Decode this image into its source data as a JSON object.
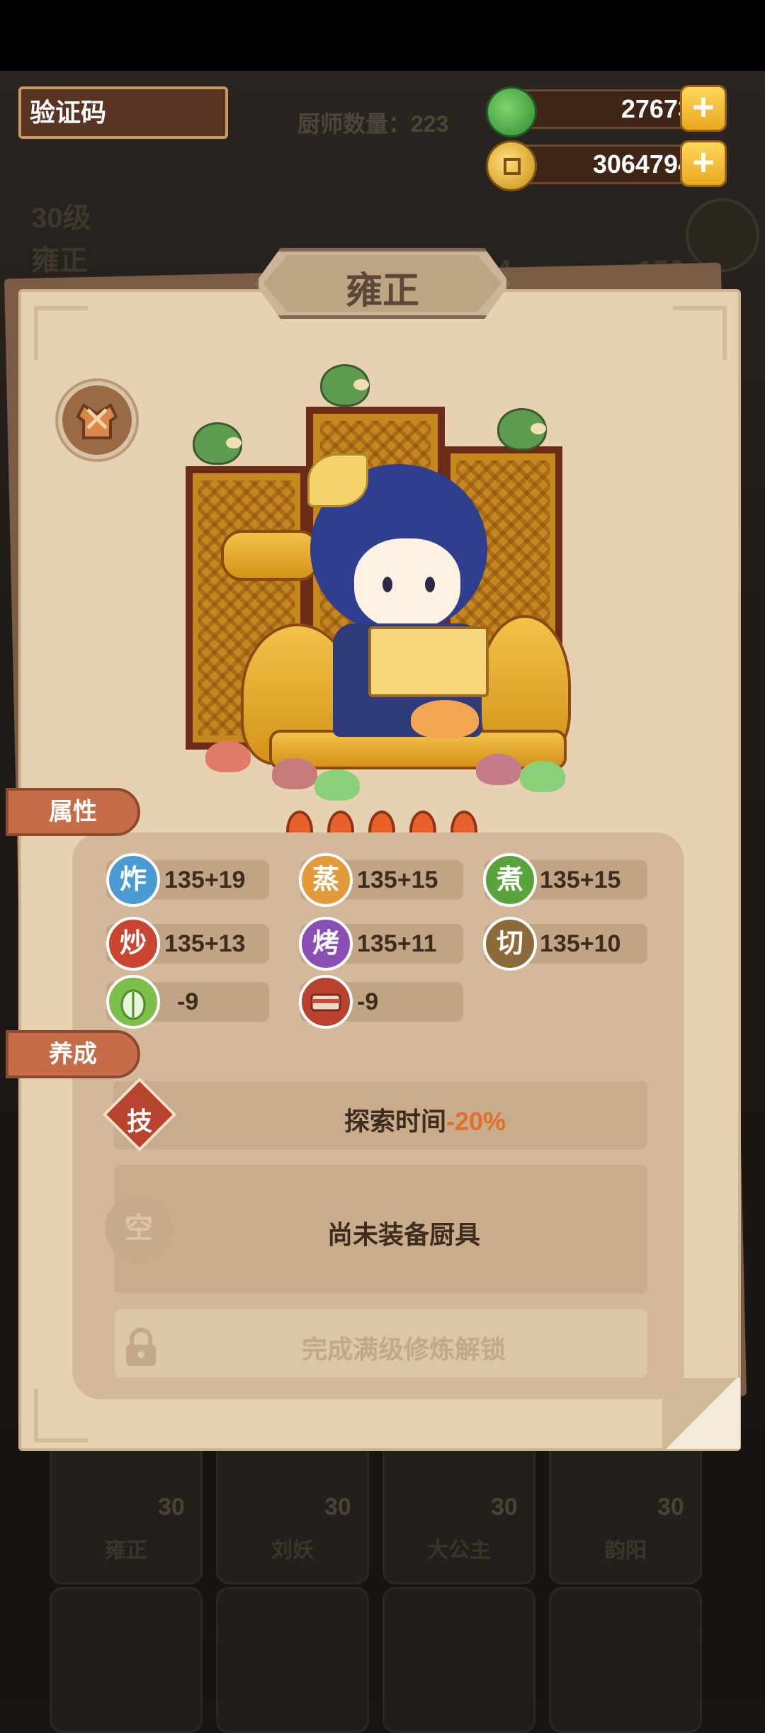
{
  "hud": {
    "captcha_label": "验证码",
    "jade_value": "27673",
    "coin_value": "3064794",
    "plus": "+",
    "colors": {
      "jade": "#3fa34a",
      "coin": "#e8b127",
      "plus": "#f5c23b"
    }
  },
  "background": {
    "chef_count": "厨师数量：223",
    "level": "30级",
    "name": "雍正",
    "num_a": "4",
    "num_b": "150",
    "cards": [
      {
        "level": "30",
        "name": "雍正"
      },
      {
        "level": "30",
        "name": "刘妖"
      },
      {
        "level": "30",
        "name": "大公主"
      },
      {
        "level": "30",
        "name": "韵阳"
      }
    ]
  },
  "panel": {
    "title": "雍正",
    "badge_icon": "chef-robe-icon",
    "flames": 5,
    "sections": {
      "attributes": "属性",
      "cultivation": "养成"
    },
    "stats": [
      {
        "icon_char": "炸",
        "value": "135+19",
        "color": "#4a9bd4"
      },
      {
        "icon_char": "蒸",
        "value": "135+15",
        "color": "#e39a3a"
      },
      {
        "icon_char": "煮",
        "value": "135+15",
        "color": "#5aa33c"
      },
      {
        "icon_char": "炒",
        "value": "135+13",
        "color": "#c9452f"
      },
      {
        "icon_char": "烤",
        "value": "135+11",
        "color": "#8a4fb5"
      },
      {
        "icon_char": "切",
        "value": "135+10",
        "color": "#8c6a3a"
      },
      {
        "icon": "cabbage-icon",
        "value": "-9",
        "color": "#7cbf4a"
      },
      {
        "icon": "meat-icon",
        "value": "-9",
        "color": "#b8422e"
      }
    ],
    "skill": {
      "badge_char": "技",
      "text": "探索时间",
      "highlight": "-20%",
      "highlight_color": "#e0702b"
    },
    "equipment": {
      "slot_char": "空",
      "text": "尚未装备厨具"
    },
    "locked": {
      "icon": "lock-icon",
      "text": "完成满级修炼解锁"
    }
  }
}
